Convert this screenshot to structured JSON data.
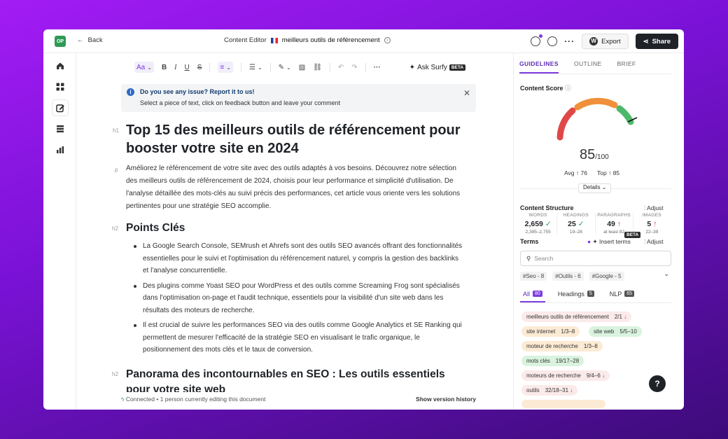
{
  "topbar": {
    "logo": "OP",
    "back": "Back",
    "editor": "Content Editor",
    "doc_title": "meilleurs outils de référencement",
    "export": "Export",
    "share": "Share"
  },
  "toolbar": {
    "font": "Aa",
    "ask": "Ask Surfy",
    "beta": "BETA"
  },
  "notice": {
    "title": "Do you see any issue? Report it to us!",
    "body": "Select a piece of text, click on feedback button and leave your comment"
  },
  "doc": {
    "h1_tag": "h1",
    "h1": "Top 15 des meilleurs outils de référencement pour booster votre site en 2024",
    "p_tag": "p",
    "p": "Améliorez le référencement de votre site avec des outils adaptés à vos besoins. Découvrez notre sélection des meilleurs outils de référencement de 2024, choisis pour leur performance et simplicité d'utilisation. De l'analyse détaillée des mots-clés au suivi précis des performances, cet article vous oriente vers les solutions pertinentes pour une stratégie SEO accomplie.",
    "h2_tag": "h2",
    "h2a": "Points Clés",
    "bullets": [
      "La Google Search Console, SEMrush et Ahrefs sont des outils SEO avancés offrant des fonctionnalités essentielles pour le suivi et l'optimisation du référencement naturel, y compris la gestion des backlinks et l'analyse concurrentielle.",
      "Des plugins comme Yoast SEO pour WordPress et des outils comme Screaming Frog sont spécialisés dans l'optimisation on-page et l'audit technique, essentiels pour la visibilité d'un site web dans les résultats des moteurs de recherche.",
      "Il est crucial de suivre les performances SEO via des outils comme Google Analytics et SE Ranking qui permettent de mesurer l'efficacité de la stratégie SEO en visualisant le trafic organique, le positionnement des mots clés et le taux de conversion."
    ],
    "h2b": "Panorama des incontournables en SEO : Les outils essentiels pour votre site web"
  },
  "footer": {
    "status": "Connected • 1 person currently editing this document",
    "history": "Show version history"
  },
  "panel": {
    "tabs": [
      "GUIDELINES",
      "OUTLINE",
      "BRIEF"
    ],
    "content_score_label": "Content Score",
    "score": "85",
    "score_max": "/100",
    "score_value": 85,
    "avg": "Avg",
    "avg_val": "76",
    "top": "Top",
    "top_val": "85",
    "details": "Details",
    "structure_label": "Content Structure",
    "adjust": "Adjust",
    "stats": [
      {
        "k": "WORDS",
        "v": "2,659",
        "r": "2,395–2,755",
        "ok": true
      },
      {
        "k": "HEADINGS",
        "v": "25",
        "r": "19–28",
        "ok": true
      },
      {
        "k": "PARAGRAPHS",
        "v": "49",
        "r": "at least 82",
        "ok": false
      },
      {
        "k": "IMAGES",
        "v": "5",
        "r": "22–39",
        "ok": false
      }
    ],
    "terms_label": "Terms",
    "insert_terms": "Insert terms",
    "beta": "BETA",
    "search_placeholder": "Search",
    "chips": [
      "#Seo - 8",
      "#Outils - 6",
      "#Google - 5"
    ],
    "term_tabs": [
      {
        "label": "All",
        "count": "80"
      },
      {
        "label": "Headings",
        "count": "5"
      },
      {
        "label": "NLP",
        "count": "65"
      }
    ],
    "terms": [
      {
        "t": "meilleurs outils de référencement",
        "c": "2/1",
        "s": "red",
        "a": "↓"
      },
      {
        "t": "site internet",
        "c": "1/3–8",
        "s": "org",
        "a": ""
      },
      {
        "t": "site web",
        "c": "5/5–10",
        "s": "grn",
        "a": ""
      },
      {
        "t": "moteur de recherche",
        "c": "1/3–8",
        "s": "org",
        "a": ""
      },
      {
        "t": "mots clés",
        "c": "19/17–28",
        "s": "grn",
        "a": ""
      },
      {
        "t": "moteurs de recherche",
        "c": "9/4–6",
        "s": "red",
        "a": "↓"
      },
      {
        "t": "outils",
        "c": "32/18–31",
        "s": "red",
        "a": "↓"
      }
    ]
  },
  "colors": {
    "accent": "#7d3ce0",
    "gauge_red": "#e04848",
    "gauge_orange": "#f0903a",
    "gauge_green": "#4cb96a"
  }
}
